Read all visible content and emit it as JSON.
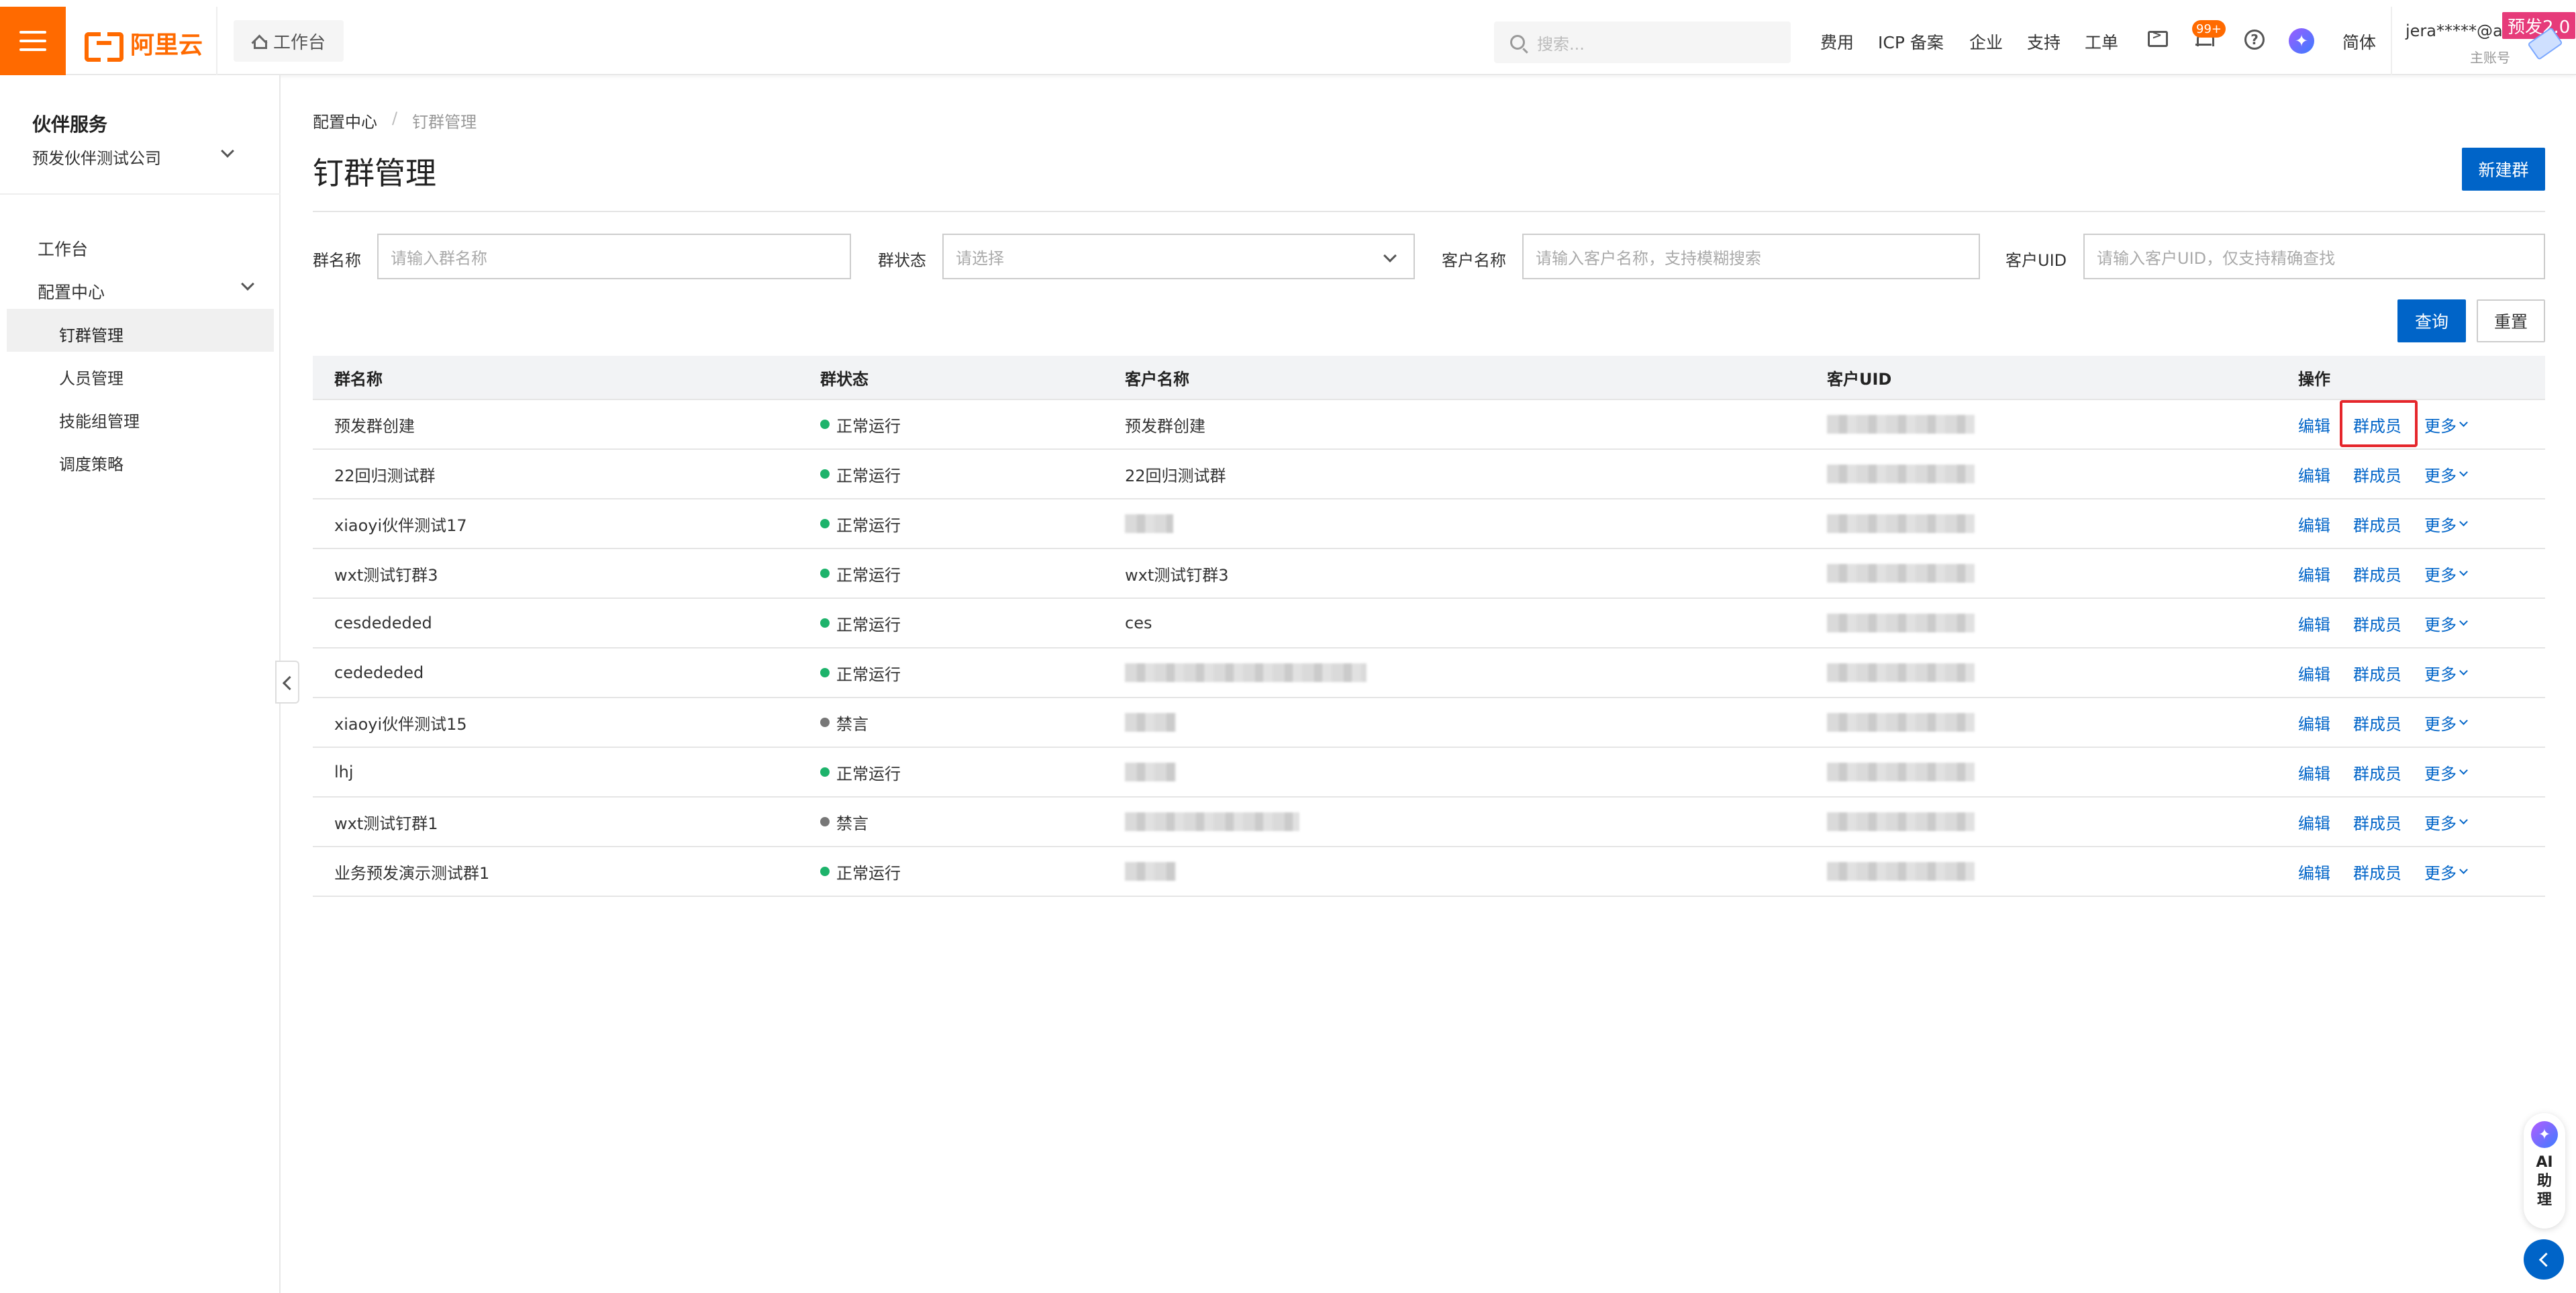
{
  "header": {
    "logo_text": "阿里云",
    "workbench_label": "工作台",
    "search_placeholder": "搜索...",
    "nav": [
      "费用",
      "ICP 备案",
      "企业",
      "支持",
      "工单"
    ],
    "notification_badge": "99+",
    "help_glyph": "?",
    "lang": "简体",
    "user_name": "jera*****@al...",
    "user_role": "主账号",
    "env_badge": "预发2.0"
  },
  "sidebar": {
    "title": "伙伴服务",
    "company": "预发伙伴测试公司",
    "items": [
      {
        "label": "工作台"
      },
      {
        "label": "配置中心"
      }
    ],
    "sub_items": [
      {
        "label": "钉群管理",
        "active": true
      },
      {
        "label": "人员管理"
      },
      {
        "label": "技能组管理"
      },
      {
        "label": "调度策略"
      }
    ]
  },
  "breadcrumb": {
    "root": "配置中心",
    "separator": "/",
    "current": "钉群管理"
  },
  "page": {
    "title": "钉群管理",
    "new_button": "新建群"
  },
  "filters": {
    "group_name_label": "群名称",
    "group_name_placeholder": "请输入群名称",
    "status_label": "群状态",
    "status_placeholder": "请选择",
    "customer_name_label": "客户名称",
    "customer_name_placeholder": "请输入客户名称，支持模糊搜索",
    "customer_uid_label": "客户UID",
    "customer_uid_placeholder": "请输入客户UID，仅支持精确查找",
    "query_button": "查询",
    "reset_button": "重置"
  },
  "table": {
    "columns": [
      "群名称",
      "群状态",
      "客户名称",
      "客户UID",
      "操作"
    ],
    "actions": {
      "edit": "编辑",
      "members": "群成员",
      "more": "更多"
    },
    "status_colors": {
      "正常运行": "#1db36b",
      "禁言": "#777777"
    },
    "rows": [
      {
        "name": "预发群创建",
        "status": "正常运行",
        "customer": "预发群创建",
        "customer_blurred": false
      },
      {
        "name": "22回归测试群",
        "status": "正常运行",
        "customer": "22回归测试群",
        "customer_blurred": false
      },
      {
        "name": "xiaoyi伙伴测试17",
        "status": "正常运行",
        "customer": "",
        "customer_blurred": true
      },
      {
        "name": "wxt测试钉群3",
        "status": "正常运行",
        "customer": "wxt测试钉群3",
        "customer_blurred": false
      },
      {
        "name": "cesdededed",
        "status": "正常运行",
        "customer": "ces",
        "customer_blurred": false
      },
      {
        "name": "cedededed",
        "status": "正常运行",
        "customer": "",
        "customer_blurred": true
      },
      {
        "name": "xiaoyi伙伴测试15",
        "status": "禁言",
        "customer": "",
        "customer_blurred": true
      },
      {
        "name": "lhj",
        "status": "正常运行",
        "customer": "",
        "customer_blurred": true
      },
      {
        "name": "wxt测试钉群1",
        "status": "禁言",
        "customer": "",
        "customer_blurred": true
      },
      {
        "name": "业务预发演示测试群1",
        "status": "正常运行",
        "customer": "",
        "customer_blurred": true
      }
    ]
  },
  "ai_assistant": {
    "label": "AI助理"
  },
  "colors": {
    "brand_orange": "#ff6a00",
    "primary_blue": "#0064c8",
    "highlight_red": "#e5262b"
  }
}
